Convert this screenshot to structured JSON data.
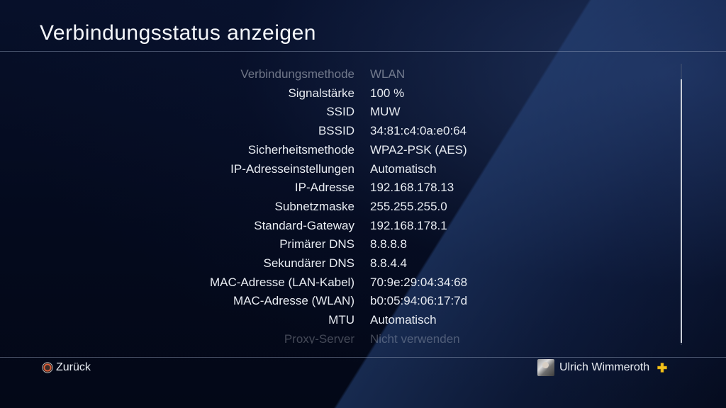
{
  "header": {
    "title": "Verbindungsstatus anzeigen"
  },
  "status_rows": [
    {
      "label": "Verbindungsmethode",
      "value": "WLAN"
    },
    {
      "label": "Signalstärke",
      "value": "100 %"
    },
    {
      "label": "SSID",
      "value": "MUW"
    },
    {
      "label": "BSSID",
      "value": "34:81:c4:0a:e0:64"
    },
    {
      "label": "Sicherheitsmethode",
      "value": "WPA2-PSK (AES)"
    },
    {
      "label": "IP-Adresseinstellungen",
      "value": "Automatisch"
    },
    {
      "label": "IP-Adresse",
      "value": "192.168.178.13"
    },
    {
      "label": "Subnetzmaske",
      "value": "255.255.255.0"
    },
    {
      "label": "Standard-Gateway",
      "value": "192.168.178.1"
    },
    {
      "label": "Primärer DNS",
      "value": "8.8.8.8"
    },
    {
      "label": "Sekundärer DNS",
      "value": "8.8.4.4"
    },
    {
      "label": "MAC-Adresse (LAN-Kabel)",
      "value": "70:9e:29:04:34:68"
    },
    {
      "label": "MAC-Adresse (WLAN)",
      "value": "b0:05:94:06:17:7d"
    },
    {
      "label": "MTU",
      "value": "Automatisch"
    },
    {
      "label": "Proxy-Server",
      "value": "Nicht verwenden"
    }
  ],
  "footer": {
    "back_label": "Zurück",
    "back_icon": "circle-button-icon",
    "user_name": "Ulrich Wimmeroth",
    "plus_icon": "playstation-plus-icon"
  },
  "colors": {
    "circle_button": "#e0603a",
    "plus": "#f2c21b"
  }
}
